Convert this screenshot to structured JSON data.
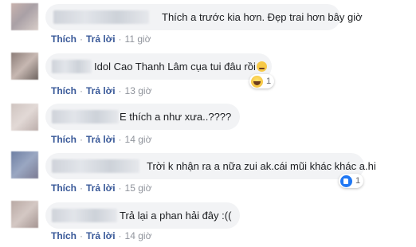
{
  "actions": {
    "like": "Thích",
    "reply": "Trả lời",
    "sep": "·"
  },
  "comments": [
    {
      "text": "Thích a trước kia hơn. Đẹp trai hơn bây giờ",
      "time": "11 giờ"
    },
    {
      "text": "Idol Cao Thanh Lâm cụa tui đâu rồi",
      "time": "13 giờ",
      "emoji": "grimace-emoji",
      "reaction": {
        "icon": "haha-reaction-icon",
        "count": "1"
      }
    },
    {
      "text": "E thích a như xưa..????",
      "time": "14 giờ"
    },
    {
      "text": "Trời k nhận ra a nữa zui ak.cái mũi khác khác a.hi",
      "time": "15 giờ",
      "reaction": {
        "icon": "like-reaction-icon",
        "count": "1"
      }
    },
    {
      "text": "Trả lại a phan hải đây :((",
      "time": "14 giờ"
    }
  ],
  "colors": {
    "link": "#385898",
    "muted": "#90949c",
    "bubble": "#f2f3f5",
    "like": "#2078f4"
  }
}
